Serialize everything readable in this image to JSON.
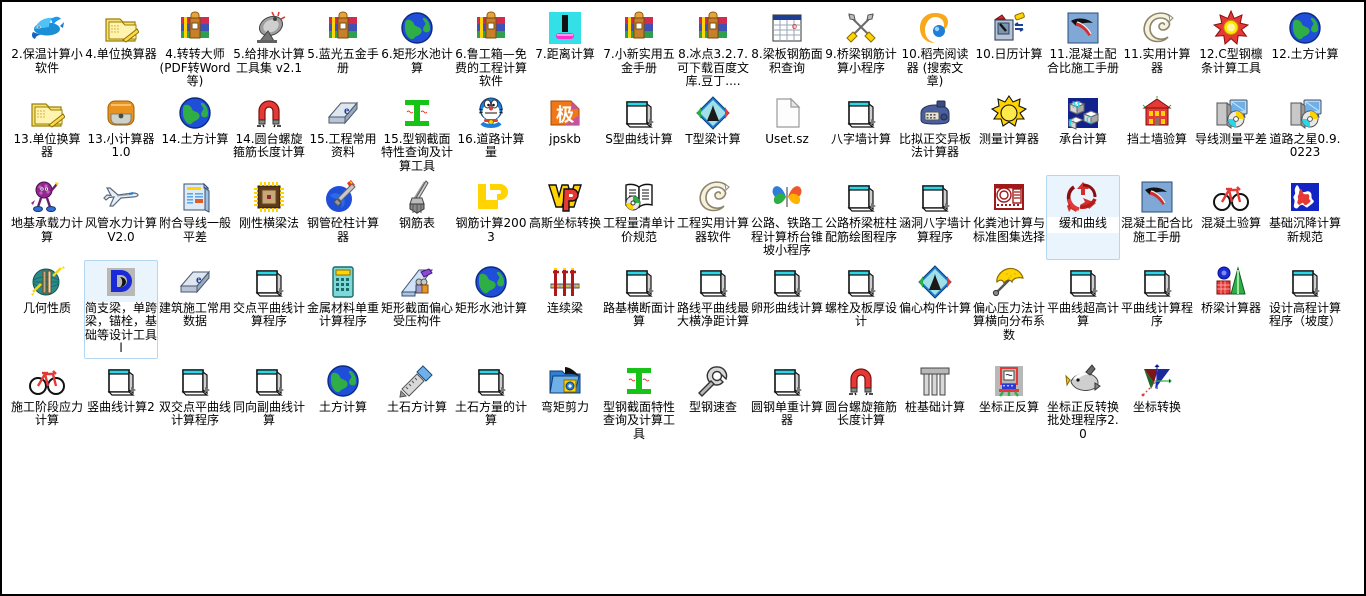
{
  "window": {
    "view_mode": "medium-icons",
    "columns": 18,
    "rows": 5,
    "background_color": "#ffffff",
    "selection_color": "#eaf4fd",
    "selection_border_color": "#b3d7f0"
  },
  "items": [
    {
      "label": "2.保温计算小软件",
      "icon": "dolphin-icon",
      "row": 1,
      "col": 1,
      "selected": false
    },
    {
      "label": "4.单位换算器",
      "icon": "folder-notes-icon",
      "row": 1,
      "col": 2,
      "selected": false
    },
    {
      "label": "4.转转大师 (PDF转Word等)",
      "icon": "winrar-archive-icon",
      "row": 1,
      "col": 3,
      "selected": false
    },
    {
      "label": "5.给排水计算工具集 v2.1",
      "icon": "satellite-dish-icon",
      "row": 1,
      "col": 4,
      "selected": false
    },
    {
      "label": "5.蓝光五金手册",
      "icon": "winrar-archive-icon",
      "row": 1,
      "col": 5,
      "selected": false
    },
    {
      "label": "6.矩形水池计算",
      "icon": "globe-icon",
      "row": 1,
      "col": 6,
      "selected": false
    },
    {
      "label": "6.鲁工箱—免费的工程计算软件",
      "icon": "winrar-archive-icon",
      "row": 1,
      "col": 7,
      "selected": false
    },
    {
      "label": "7.距离计算",
      "icon": "cyan-tool-icon",
      "row": 1,
      "col": 8,
      "selected": false
    },
    {
      "label": "7.小新实用五金手册",
      "icon": "winrar-archive-icon",
      "row": 1,
      "col": 9,
      "selected": false
    },
    {
      "label": "8.冰点3.2.7.可下载百度文库.豆丁....",
      "icon": "winrar-archive-icon",
      "row": 1,
      "col": 10,
      "selected": false
    },
    {
      "label": "8.梁板钢筋面积查询",
      "icon": "spreadsheet-icon",
      "row": 1,
      "col": 11,
      "selected": false
    },
    {
      "label": "9.桥梁钢筋计算小程序",
      "icon": "crossed-swords-icon",
      "row": 1,
      "col": 12,
      "selected": false
    },
    {
      "label": "10.稻壳阅读器 (搜索文章)",
      "icon": "orange-swirl-icon",
      "row": 1,
      "col": 13,
      "selected": false
    },
    {
      "label": "10.日历计算",
      "icon": "calendar-swap-icon",
      "row": 1,
      "col": 14,
      "selected": false
    },
    {
      "label": "11.混凝土配合比施工手册",
      "icon": "pickaxe-blue-icon",
      "row": 1,
      "col": 15,
      "selected": false
    },
    {
      "label": "11.实用计算器",
      "icon": "shell-spiral-icon",
      "row": 1,
      "col": 16,
      "selected": false
    },
    {
      "label": "12.C型钢檩条计算工具",
      "icon": "starburst-icon",
      "row": 1,
      "col": 17,
      "selected": false
    },
    {
      "label": "12.土方计算",
      "icon": "globe-icon",
      "row": 1,
      "col": 18,
      "selected": false
    },
    {
      "label": "13.单位换算器",
      "icon": "folder-notes-icon",
      "row": 2,
      "col": 1,
      "selected": false
    },
    {
      "label": "13.小计算器1.0",
      "icon": "orange-rounded-icon",
      "row": 2,
      "col": 2,
      "selected": false
    },
    {
      "label": "14.土方计算",
      "icon": "globe-icon",
      "row": 2,
      "col": 3,
      "selected": false
    },
    {
      "label": "14.圆台螺旋箍筋长度计算",
      "icon": "magnet-icon",
      "row": 2,
      "col": 4,
      "selected": false
    },
    {
      "label": "15.工程常用资料",
      "icon": "ebook-icon",
      "row": 2,
      "col": 5,
      "selected": false
    },
    {
      "label": "15.型钢截面特性查询及计算工具",
      "icon": "i-beam-green-icon",
      "row": 2,
      "col": 6,
      "selected": false
    },
    {
      "label": "16.道路计算量",
      "icon": "doraemon-icon",
      "row": 2,
      "col": 7,
      "selected": false
    },
    {
      "label": "jpskb",
      "icon": "ji-orange-icon",
      "row": 2,
      "col": 8,
      "selected": false
    },
    {
      "label": "S型曲线计算",
      "icon": "script-doc-icon",
      "row": 2,
      "col": 9,
      "selected": false
    },
    {
      "label": "T型梁计算",
      "icon": "diamond-photo-icon",
      "row": 2,
      "col": 10,
      "selected": false
    },
    {
      "label": "Uset.sz",
      "icon": "blank-file-icon",
      "row": 2,
      "col": 11,
      "selected": false
    },
    {
      "label": "八字墙计算",
      "icon": "script-doc-icon",
      "row": 2,
      "col": 12,
      "selected": false
    },
    {
      "label": "比拟正交异板法计算器",
      "icon": "blue-calculator-device-icon",
      "row": 2,
      "col": 13,
      "selected": false
    },
    {
      "label": "测量计算器",
      "icon": "sun-yellow-icon",
      "row": 2,
      "col": 14,
      "selected": false
    },
    {
      "label": "承台计算",
      "icon": "mfc-cubes-icon",
      "row": 2,
      "col": 15,
      "selected": false
    },
    {
      "label": "挡土墙验算",
      "icon": "red-house-icon",
      "row": 2,
      "col": 16,
      "selected": false
    },
    {
      "label": "导线测量平差",
      "icon": "setup-cd-icon",
      "row": 2,
      "col": 17,
      "selected": false
    },
    {
      "label": "道路之星0.9.0223",
      "icon": "setup-cd-icon",
      "row": 2,
      "col": 18,
      "selected": false
    },
    {
      "label": "地基承载力计算",
      "icon": "purple-mascot-icon",
      "row": 3,
      "col": 1,
      "selected": false
    },
    {
      "label": "风管水力计算V2.0",
      "icon": "airplane-icon",
      "row": 3,
      "col": 2,
      "selected": false
    },
    {
      "label": "附合导线一般平差",
      "icon": "blue-report-icon",
      "row": 3,
      "col": 3,
      "selected": false
    },
    {
      "label": "刚性横梁法",
      "icon": "chip-icon",
      "row": 3,
      "col": 4,
      "selected": false
    },
    {
      "label": "钢管砼柱计算器",
      "icon": "torch-blue-icon",
      "row": 3,
      "col": 5,
      "selected": false
    },
    {
      "label": "钢筋表",
      "icon": "vibrator-tool-icon",
      "row": 3,
      "col": 6,
      "selected": false
    },
    {
      "label": "钢筋计算2003",
      "icon": "yellow-ld-icon",
      "row": 3,
      "col": 7,
      "selected": false
    },
    {
      "label": "高斯坐标转换",
      "icon": "wp-logo-icon",
      "row": 3,
      "col": 8,
      "selected": false
    },
    {
      "label": "工程量清单计价规范",
      "icon": "book-cd-icon",
      "row": 3,
      "col": 9,
      "selected": false
    },
    {
      "label": "工程实用计算器软件",
      "icon": "shell-spiral-icon",
      "row": 3,
      "col": 10,
      "selected": false
    },
    {
      "label": "公路、铁路工程计算桥台锥坡小程序",
      "icon": "butterfly-icon",
      "row": 3,
      "col": 11,
      "selected": false
    },
    {
      "label": "公路桥梁桩柱配筋绘图程序",
      "icon": "script-doc-icon",
      "row": 3,
      "col": 12,
      "selected": false
    },
    {
      "label": "涵洞八字墙计算程序",
      "icon": "script-doc-icon",
      "row": 3,
      "col": 13,
      "selected": false
    },
    {
      "label": "化粪池计算与标准图集选择",
      "icon": "red-ornament-icon",
      "row": 3,
      "col": 14,
      "selected": false
    },
    {
      "label": "缓和曲线",
      "icon": "recycle-red-icon",
      "row": 3,
      "col": 15,
      "selected": true
    },
    {
      "label": "混凝土配合比施工手册",
      "icon": "pickaxe-blue-icon",
      "row": 3,
      "col": 16,
      "selected": false
    },
    {
      "label": "混凝土验算",
      "icon": "bicycle-icon",
      "row": 3,
      "col": 17,
      "selected": false
    },
    {
      "label": "基础沉降计算新规范",
      "icon": "blue-red-map-icon",
      "row": 3,
      "col": 18,
      "selected": false
    },
    {
      "label": "几何性质",
      "icon": "teal-sphere-icon",
      "row": 4,
      "col": 1,
      "selected": false
    },
    {
      "label": "简支梁，单跨梁，锚栓，基础等设计工具l",
      "icon": "d-blue-letter-icon",
      "row": 4,
      "col": 2,
      "selected": true
    },
    {
      "label": "建筑施工常用数据",
      "icon": "ebook-icon",
      "row": 4,
      "col": 3,
      "selected": false
    },
    {
      "label": "交点平曲线计算程序",
      "icon": "script-doc-icon",
      "row": 4,
      "col": 4,
      "selected": false
    },
    {
      "label": "金属材料单重计算程序",
      "icon": "calculator-teal-icon",
      "row": 4,
      "col": 5,
      "selected": false
    },
    {
      "label": "矩形截面偏心受压构件",
      "icon": "blue-people-icon",
      "row": 4,
      "col": 6,
      "selected": false
    },
    {
      "label": "矩形水池计算",
      "icon": "globe-icon",
      "row": 4,
      "col": 7,
      "selected": false
    },
    {
      "label": "连续梁",
      "icon": "bridge-red-icon",
      "row": 4,
      "col": 8,
      "selected": false
    },
    {
      "label": "路基横断面计算",
      "icon": "script-doc-icon",
      "row": 4,
      "col": 9,
      "selected": false
    },
    {
      "label": "路线平曲线最大横净距计算",
      "icon": "script-doc-icon",
      "row": 4,
      "col": 10,
      "selected": false
    },
    {
      "label": "卵形曲线计算",
      "icon": "script-doc-icon",
      "row": 4,
      "col": 11,
      "selected": false
    },
    {
      "label": "螺栓及板厚设计",
      "icon": "script-doc-icon",
      "row": 4,
      "col": 12,
      "selected": false
    },
    {
      "label": "偏心构件计算",
      "icon": "diamond-photo-icon",
      "row": 4,
      "col": 13,
      "selected": false
    },
    {
      "label": "偏心压力法计算横向分布系数",
      "icon": "umbrella-yellow-icon",
      "row": 4,
      "col": 14,
      "selected": false
    },
    {
      "label": "平曲线超高计算",
      "icon": "script-doc-icon",
      "row": 4,
      "col": 15,
      "selected": false
    },
    {
      "label": "平曲线计算程序",
      "icon": "script-doc-icon",
      "row": 4,
      "col": 16,
      "selected": false
    },
    {
      "label": "桥梁计算器",
      "icon": "cube-tree-icon",
      "row": 4,
      "col": 17,
      "selected": false
    },
    {
      "label": "设计高程计算程序（坡度）",
      "icon": "script-doc-icon",
      "row": 4,
      "col": 18,
      "selected": false
    },
    {
      "label": "施工阶段应力计算",
      "icon": "bicycle-icon",
      "row": 5,
      "col": 1,
      "selected": false
    },
    {
      "label": "竖曲线计算2",
      "icon": "script-doc-icon",
      "row": 5,
      "col": 2,
      "selected": false
    },
    {
      "label": "双交点平曲线计算程序",
      "icon": "script-doc-icon",
      "row": 5,
      "col": 3,
      "selected": false
    },
    {
      "label": "同向副曲线计算",
      "icon": "script-doc-icon",
      "row": 5,
      "col": 4,
      "selected": false
    },
    {
      "label": "土方计算",
      "icon": "globe-icon",
      "row": 5,
      "col": 5,
      "selected": false
    },
    {
      "label": "土石方计算",
      "icon": "ruler-hammer-icon",
      "row": 5,
      "col": 6,
      "selected": false
    },
    {
      "label": "土石方量的计算",
      "icon": "script-doc-icon",
      "row": 5,
      "col": 7,
      "selected": false
    },
    {
      "label": "弯矩剪力",
      "icon": "blue-folder-gear-icon",
      "row": 5,
      "col": 8,
      "selected": false
    },
    {
      "label": "型钢截面特性查询及计算工具",
      "icon": "i-beam-green-icon",
      "row": 5,
      "col": 9,
      "selected": false
    },
    {
      "label": "型钢速查",
      "icon": "wrench-icon",
      "row": 5,
      "col": 10,
      "selected": false
    },
    {
      "label": "圆钢单重计算器",
      "icon": "script-doc-icon",
      "row": 5,
      "col": 11,
      "selected": false
    },
    {
      "label": "圆台螺旋箍筋长度计算",
      "icon": "magnet-icon",
      "row": 5,
      "col": 12,
      "selected": false
    },
    {
      "label": "桩基础计算",
      "icon": "pile-foundation-icon",
      "row": 5,
      "col": 13,
      "selected": false
    },
    {
      "label": "坐标正反算",
      "icon": "total-station-icon",
      "row": 5,
      "col": 14,
      "selected": false
    },
    {
      "label": "坐标正反转换批处理程序2.0",
      "icon": "fish-icon",
      "row": 5,
      "col": 15,
      "selected": false
    },
    {
      "label": "坐标转换",
      "icon": "axes-triangle-icon",
      "row": 5,
      "col": 16,
      "selected": false
    }
  ]
}
